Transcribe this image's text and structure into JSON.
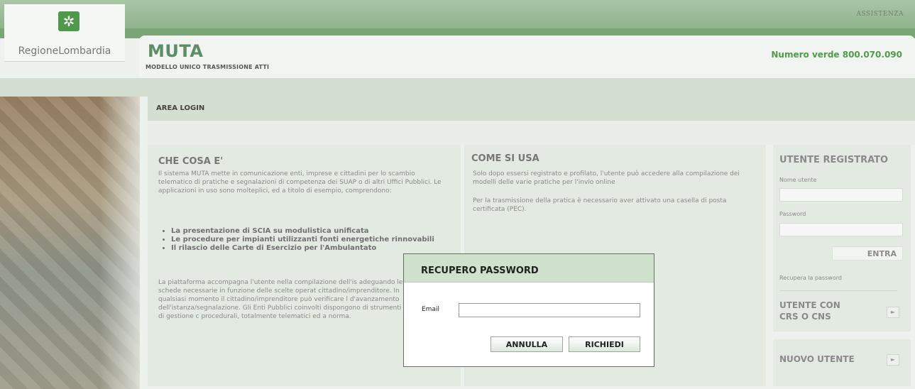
{
  "header": {
    "logo_text": "RegioneLombardia",
    "assistance_link": "ASSISTENZA",
    "app_title": "MUTA",
    "app_subtitle": "MODELLO UNICO TRASMISSIONE ATTI",
    "phone": "Numero verde 800.070.090"
  },
  "area": {
    "title": "AREA LOGIN"
  },
  "what_is": {
    "title": "CHE COSA E'",
    "intro": "Il sistema MUTA mette in comunicazione enti, imprese e cittadini per lo scambio telematico di pratiche e segnalazioni di competenza dei SUAP o di altri Uffici Pubblici. Le applicazioni in uso sono molteplici, ed a titolo di esempio, comprendono:",
    "features": [
      "La presentazione di SCIA su modulistica unificata",
      "Le procedure per impianti utilizzanti fonti energetiche rinnovabili",
      "Il rilascio delle Carte di Esercizio per l'Ambulantato"
    ],
    "outro": "La piattaforma accompagna l'utente nella compilazione dell'is adeguando le schede necessarie in funzione delle scelte operat cittadino/imprenditore. In qualsiasi momento il cittadino/imprenditore può verificare l d'avanzamento dell'istanza/segnalazione. Gli Enti Pubblici coinvolti dispongono di strumenti di gestione c procedurali, totalmente telematici ed a norma."
  },
  "how_to": {
    "title": "COME SI USA",
    "para1": "Solo dopo essersi registrato e profilato, l'utente può accedere alla compilazione dei modelli delle varie pratiche per l'invio online",
    "para2": "Per la trasmissione della pratica è necessario aver attivato una casella di posta certificata (PEC)."
  },
  "login": {
    "title": "UTENTE REGISTRATO",
    "username_label": "Nome utente",
    "password_label": "Password",
    "submit": "ENTRA",
    "recover": "Recupera la password",
    "crs_title": "UTENTE CON CRS O CNS",
    "new_user": "NUOVO UTENTE",
    "arrow": "►"
  },
  "modal": {
    "title": "RECUPERO PASSWORD",
    "email_label": "Email",
    "email_value": "",
    "cancel": "ANNULLA",
    "request": "RICHIEDI"
  },
  "colors": {
    "brand_green": "#5b8e63",
    "header_green": "#7aa677",
    "modal_header": "#cfe2cc"
  }
}
